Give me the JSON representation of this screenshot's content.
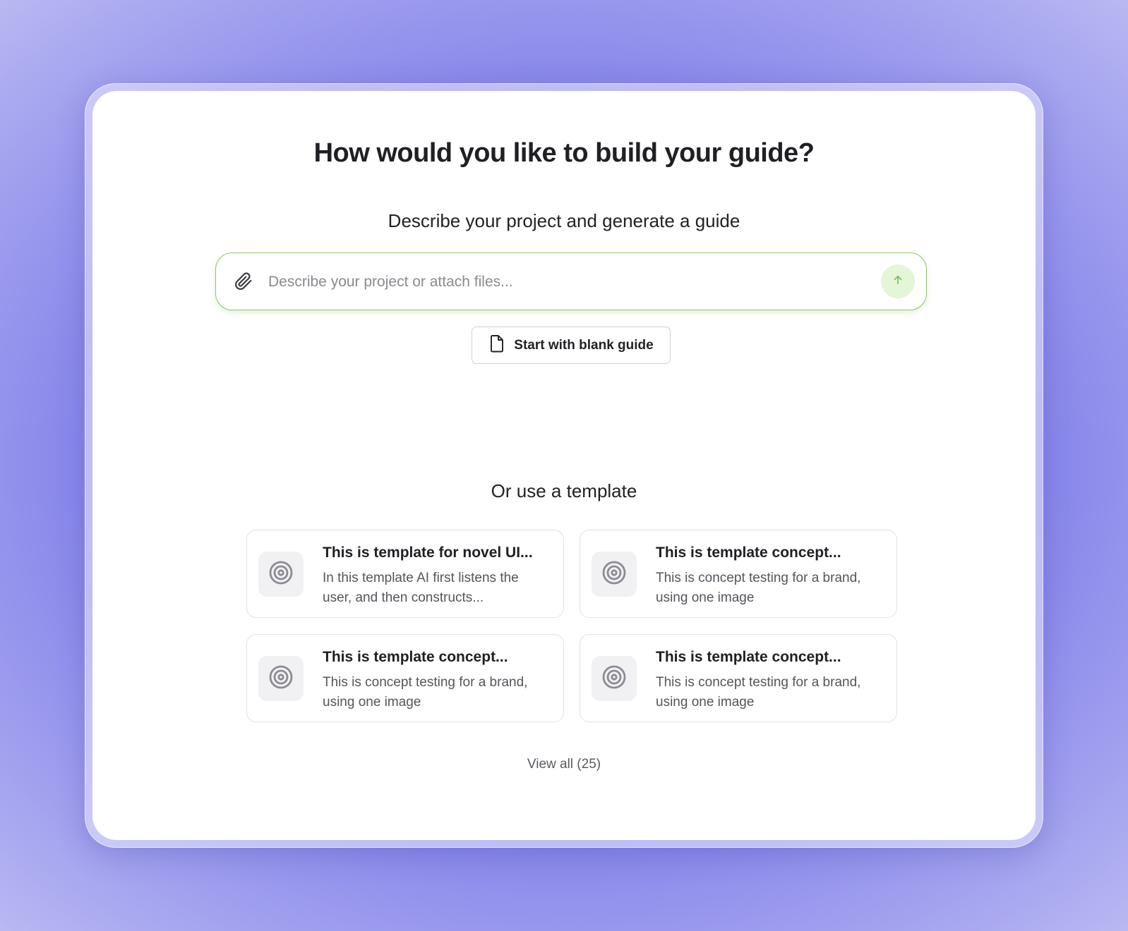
{
  "heading": "How would you like to build your guide?",
  "generate": {
    "subtitle": "Describe your project and generate a guide",
    "input_placeholder": "Describe your project or attach files...",
    "input_value": "",
    "attach_icon": "paperclip-icon",
    "send_icon": "arrow-up-icon",
    "blank_button_label": "Start with blank guide",
    "blank_button_icon": "document-icon"
  },
  "templates": {
    "section_title": "Or use a template",
    "items": [
      {
        "title": "This is template for novel UI...",
        "description": "In this template AI first listens the user, and then constructs...",
        "icon": "target-icon"
      },
      {
        "title": "This is template concept...",
        "description": "This is concept testing for a brand, using one image",
        "icon": "target-icon"
      },
      {
        "title": "This is template concept...",
        "description": "This is concept testing for a brand, using one image",
        "icon": "target-icon"
      },
      {
        "title": "This is template concept...",
        "description": "This is concept testing for a brand, using one image",
        "icon": "target-icon"
      }
    ],
    "view_all_label": "View all (25)"
  },
  "colors": {
    "background": "#7574e8",
    "card": "#ffffff",
    "input_border": "#8dc46b",
    "send_button_bg": "#e3f6d6",
    "send_arrow": "#7fb865",
    "template_border": "#e3e3e8",
    "icon_gray": "#8b8b94"
  }
}
